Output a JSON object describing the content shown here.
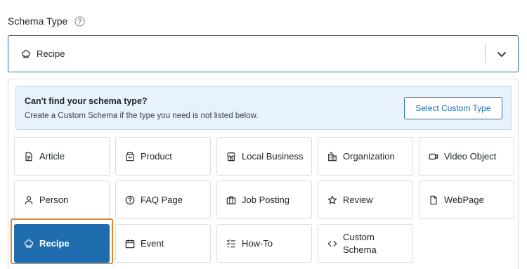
{
  "field": {
    "label": "Schema Type",
    "help_icon": "help-circle-icon"
  },
  "select": {
    "value": "Recipe",
    "value_icon": "chef-hat-icon",
    "chevron_icon": "chevron-down-icon"
  },
  "notice": {
    "title": "Can't find your schema type?",
    "subtitle": "Create a Custom Schema if the type you need is not listed below.",
    "button_label": "Select Custom Type"
  },
  "types": [
    {
      "label": "Article",
      "icon": "document-icon"
    },
    {
      "label": "Product",
      "icon": "shopping-bag-icon"
    },
    {
      "label": "Local Business",
      "icon": "storefront-icon"
    },
    {
      "label": "Organization",
      "icon": "building-icon"
    },
    {
      "label": "Video Object",
      "icon": "video-camera-icon"
    },
    {
      "label": "Person",
      "icon": "person-icon"
    },
    {
      "label": "FAQ Page",
      "icon": "question-circle-icon"
    },
    {
      "label": "Job Posting",
      "icon": "briefcase-icon"
    },
    {
      "label": "Review",
      "icon": "star-icon"
    },
    {
      "label": "WebPage",
      "icon": "page-icon"
    },
    {
      "label": "Recipe",
      "icon": "chef-hat-icon",
      "selected": true
    },
    {
      "label": "Event",
      "icon": "calendar-icon"
    },
    {
      "label": "How-To",
      "icon": "checklist-icon"
    },
    {
      "label": "Custom Schema",
      "icon": "code-icon"
    }
  ],
  "colors": {
    "accent": "#1f6dae",
    "highlight": "#f0831e",
    "notice_bg": "#e7f2fc"
  }
}
